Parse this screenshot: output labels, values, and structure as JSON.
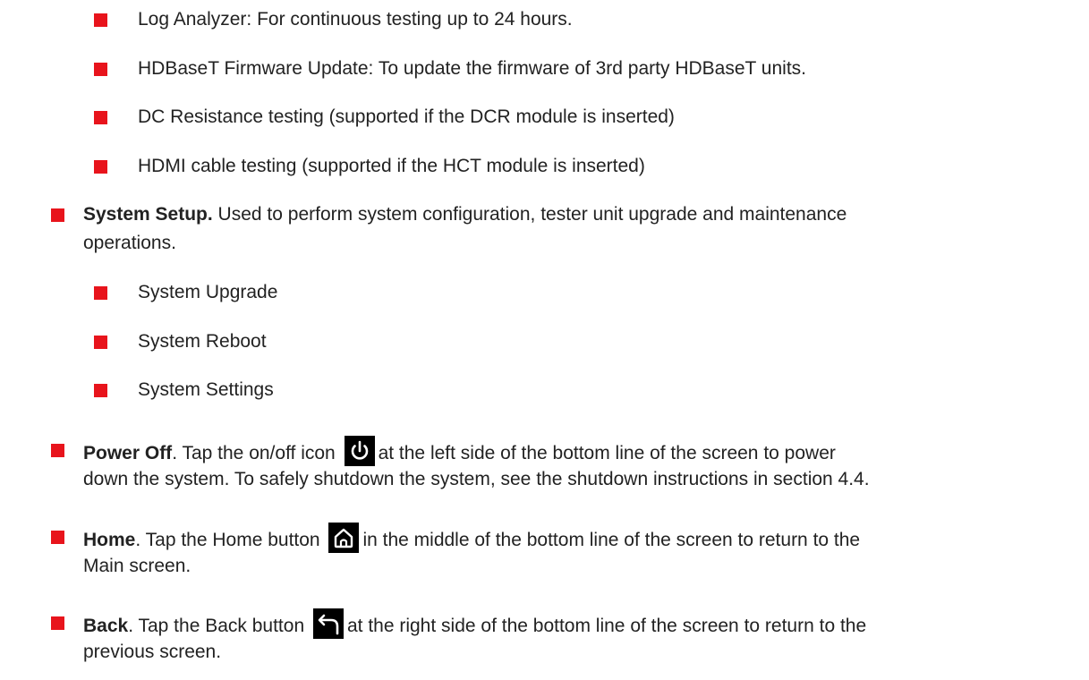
{
  "sub_items_top": [
    "Log Analyzer: For continuous testing up to 24 hours.",
    "HDBaseT Firmware Update: To update the firmware of 3rd party HDBaseT units.",
    "DC Resistance testing (supported if the DCR module is inserted)",
    "HDMI cable testing (supported if the HCT module is inserted)"
  ],
  "system_setup": {
    "title": "System Setup.",
    "text_line1": " Used to perform system configuration, tester unit upgrade and maintenance",
    "text_line2": "operations.",
    "sub_items": [
      "System Upgrade",
      "System Reboot",
      "System Settings"
    ]
  },
  "power_off": {
    "title": "Power Off",
    "text_a": ".  Tap the on/off icon",
    "icon": "power-icon",
    "text_b": "at the left side of the bottom line of the screen to power",
    "text_line2": "down the system.  To safely shutdown the system, see the shutdown instructions in section 4.4."
  },
  "home": {
    "title": "Home",
    "text_a": ". Tap the Home button",
    "icon": "home-icon",
    "text_b": "in the middle of the bottom line of the screen to return to the",
    "text_line2": "Main screen."
  },
  "back": {
    "title": "Back",
    "text_a": ". Tap the Back button",
    "icon": "back-arrow-icon",
    "text_b": "at the right side of the bottom line of the screen to return to the",
    "text_line2": "previous screen."
  },
  "colors": {
    "bullet": "#e8141c",
    "text": "#222222",
    "icon_bg": "#000000",
    "icon_fg": "#ffffff"
  }
}
